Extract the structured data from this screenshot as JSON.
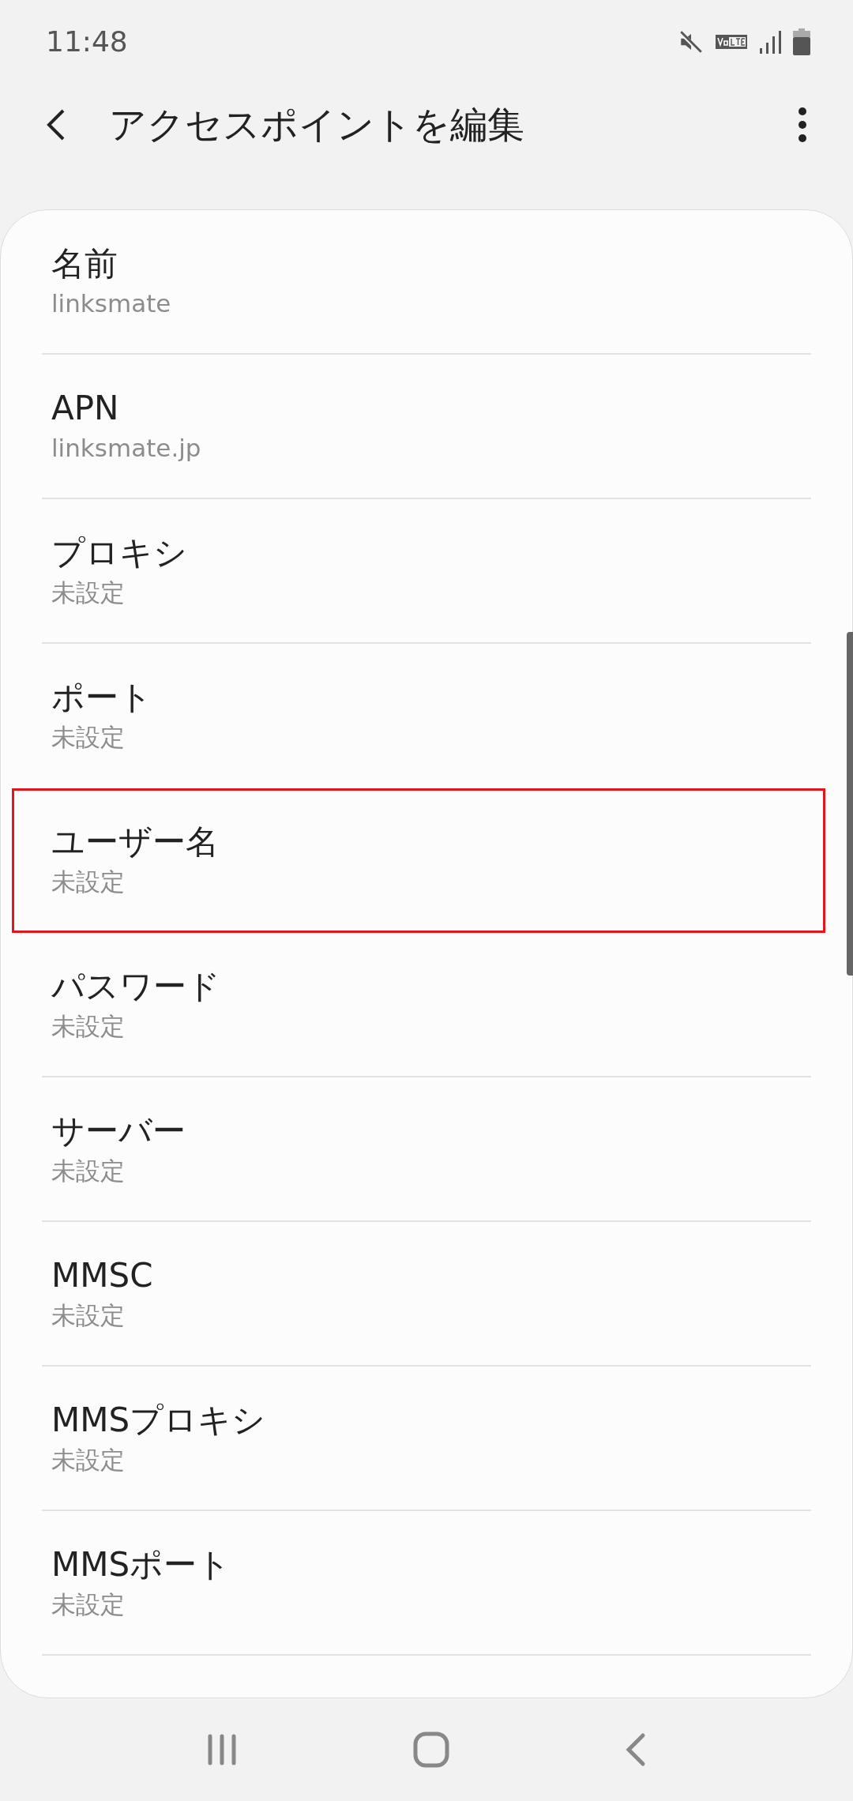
{
  "status_bar": {
    "time": "11:48"
  },
  "app_bar": {
    "title": "アクセスポイントを編集"
  },
  "items": [
    {
      "label": "名前",
      "value": "linksmate",
      "highlighted": false
    },
    {
      "label": "APN",
      "value": "linksmate.jp",
      "highlighted": false
    },
    {
      "label": "プロキシ",
      "value": "未設定",
      "highlighted": false
    },
    {
      "label": "ポート",
      "value": "未設定",
      "highlighted": false
    },
    {
      "label": "ユーザー名",
      "value": "未設定",
      "highlighted": true
    },
    {
      "label": "パスワード",
      "value": "未設定",
      "highlighted": false
    },
    {
      "label": "サーバー",
      "value": "未設定",
      "highlighted": false
    },
    {
      "label": "MMSC",
      "value": "未設定",
      "highlighted": false
    },
    {
      "label": "MMSプロキシ",
      "value": "未設定",
      "highlighted": false
    },
    {
      "label": "MMSポート",
      "value": "未設定",
      "highlighted": false
    }
  ]
}
